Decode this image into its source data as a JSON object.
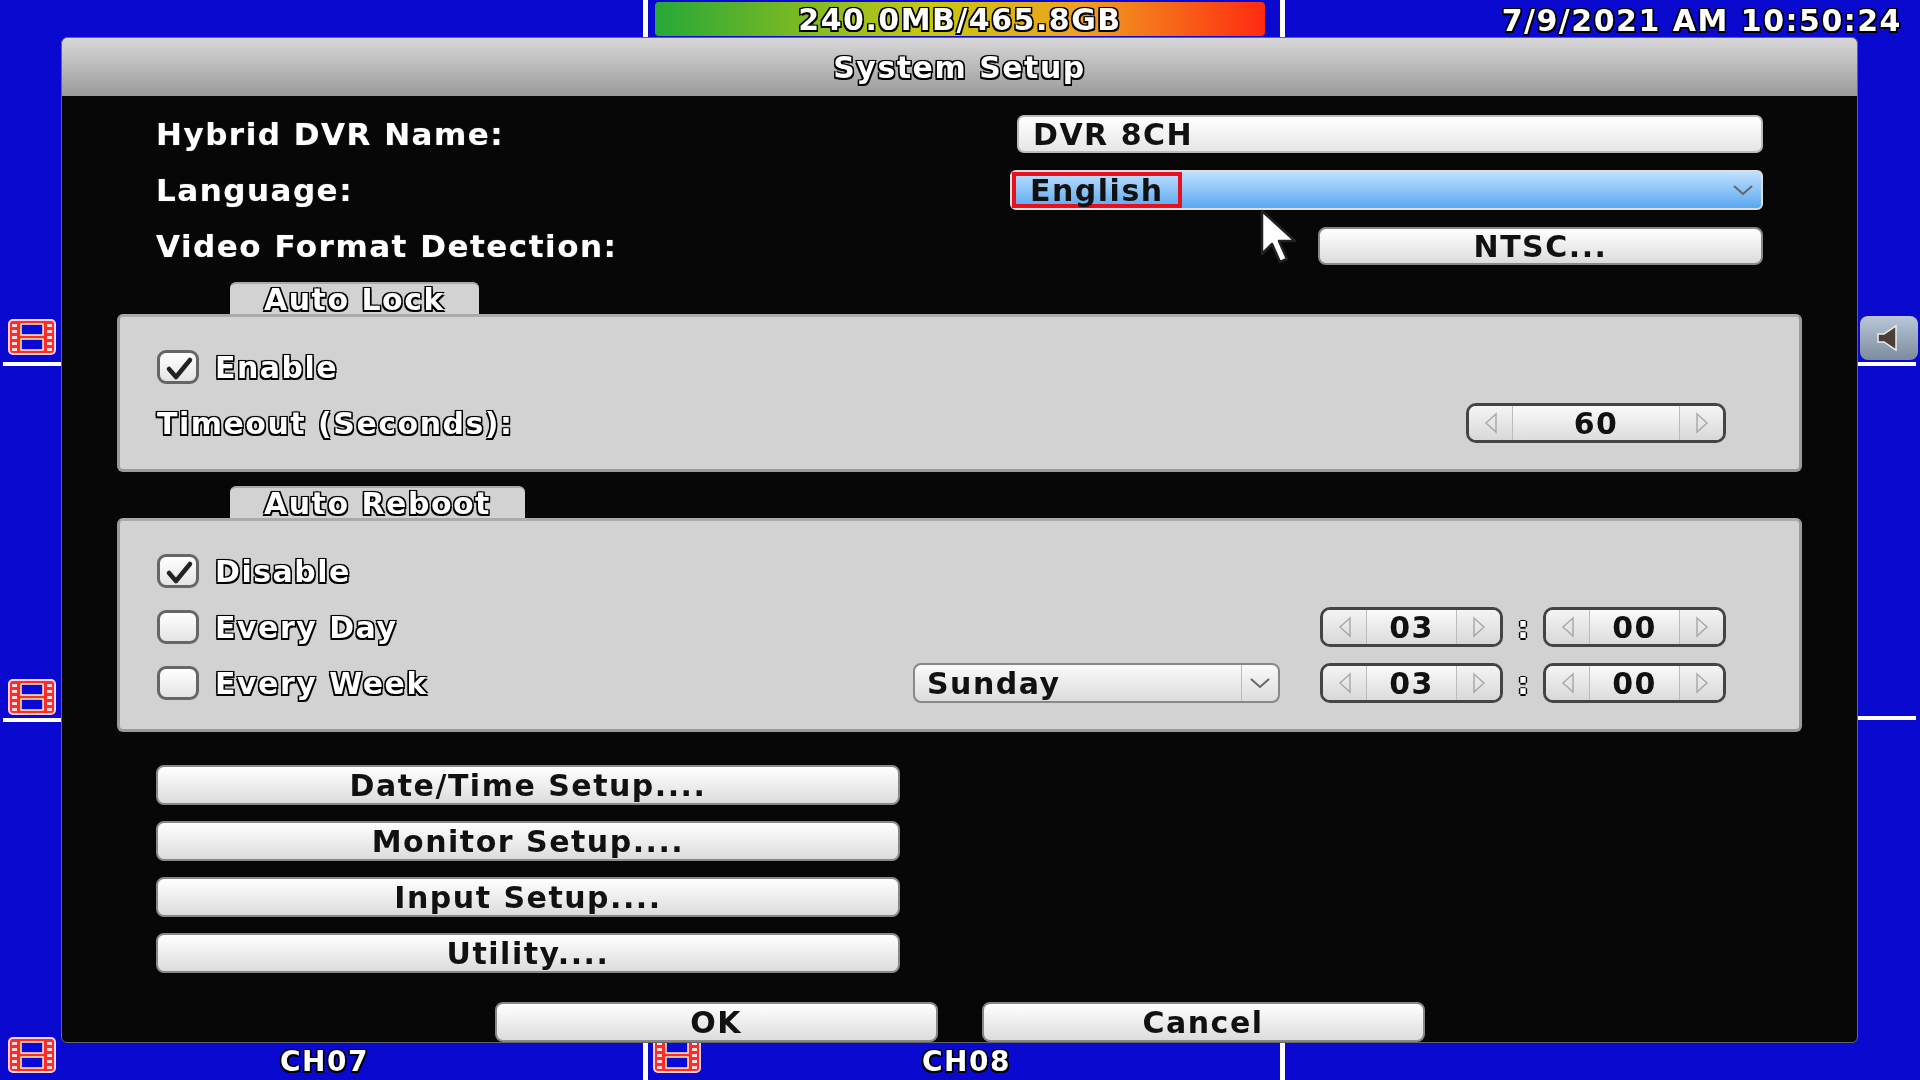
{
  "status_bar": {
    "storage": "240.0MB/465.8GB",
    "datetime": "7/9/2021 AM 10:50:24"
  },
  "dialog": {
    "title": "System Setup",
    "fields": [
      {
        "kind": "text",
        "label": "Hybrid DVR Name:",
        "value": "DVR 8CH"
      },
      {
        "kind": "dropdown",
        "label": "Language:",
        "value": "English",
        "highlighted": true
      },
      {
        "kind": "button",
        "label": "Video Format Detection:",
        "value": "NTSC..."
      }
    ],
    "auto_lock": {
      "title": "Auto Lock",
      "enable": {
        "label": "Enable",
        "checked": true
      },
      "timeout": {
        "label": "Timeout (Seconds):",
        "value": "60"
      }
    },
    "auto_reboot": {
      "title": "Auto Reboot",
      "options": [
        {
          "kind": "plain",
          "label": "Disable",
          "checked": true
        },
        {
          "kind": "daily",
          "label": "Every Day",
          "checked": false,
          "hour": "03",
          "separator": ":",
          "minute": "00"
        },
        {
          "kind": "weekly",
          "label": "Every Week",
          "checked": false,
          "day": "Sunday",
          "hour": "03",
          "separator": ":",
          "minute": "00"
        }
      ]
    },
    "setup_buttons": [
      "Date/Time Setup....",
      "Monitor Setup....",
      "Input Setup....",
      "Utility...."
    ],
    "actions": [
      "OK",
      "Cancel"
    ]
  },
  "channels": [
    {
      "label": "CH07"
    },
    {
      "label": "CH08"
    }
  ]
}
